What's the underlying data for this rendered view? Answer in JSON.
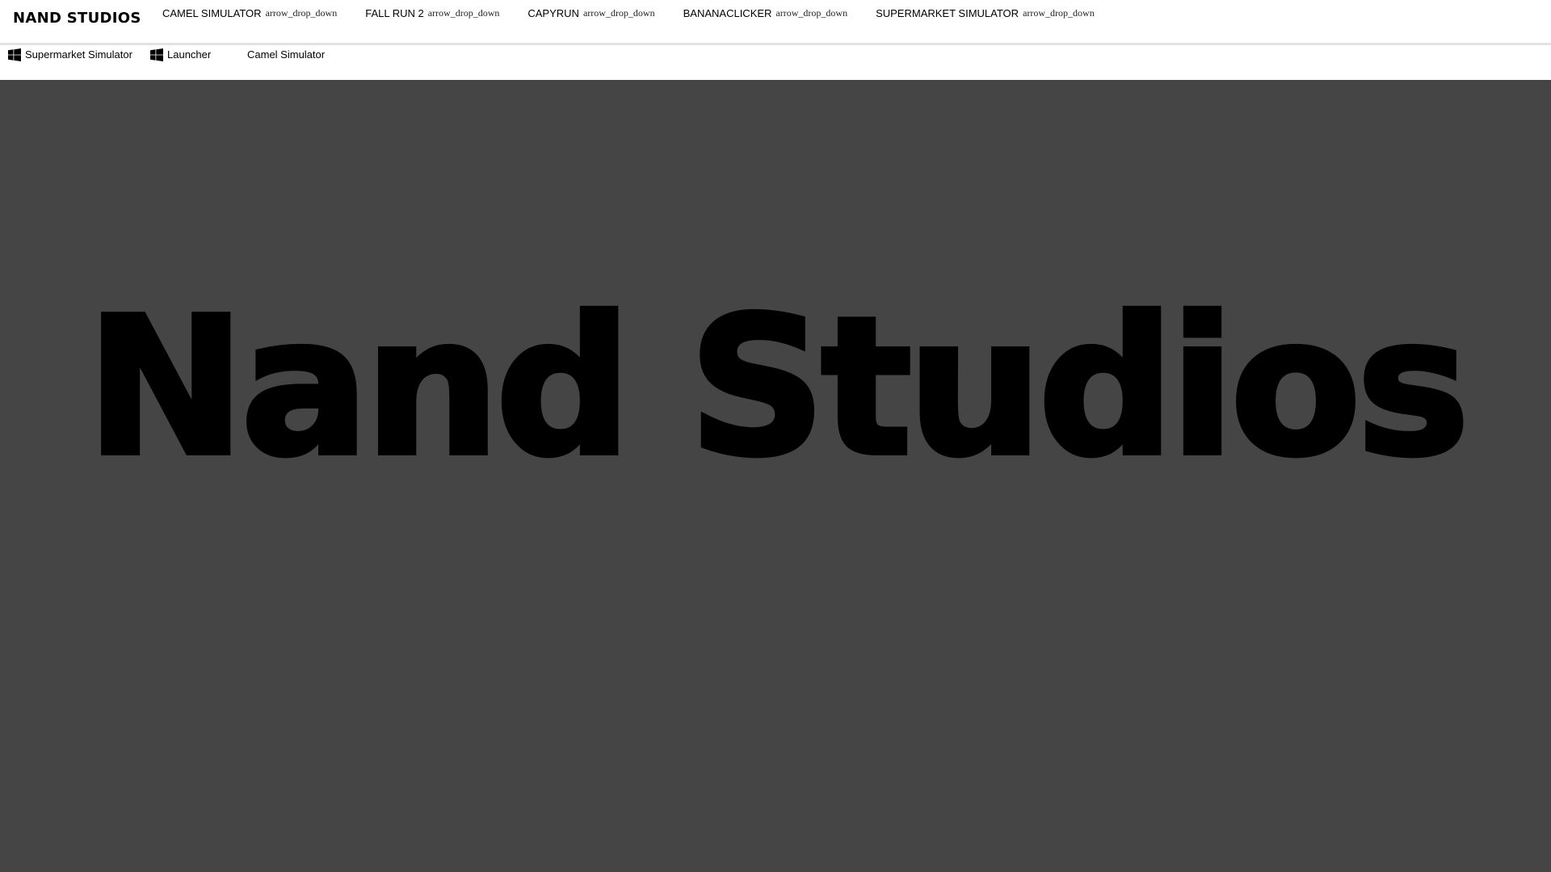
{
  "header": {
    "brand": "NAND STUDIOS",
    "nav": [
      {
        "label": "CAMEL SIMULATOR",
        "icon": "arrow_drop_down"
      },
      {
        "label": "FALL RUN 2",
        "icon": "arrow_drop_down"
      },
      {
        "label": "CAPYRUN",
        "icon": "arrow_drop_down"
      },
      {
        "label": "BANANACLICKER",
        "icon": "arrow_drop_down"
      },
      {
        "label": "SUPERMARKET SIMULATOR",
        "icon": "arrow_drop_down"
      }
    ]
  },
  "bookmarks": [
    {
      "label": "Supermarket Simulator",
      "icon": "windows-icon"
    },
    {
      "label": "Launcher",
      "icon": "windows-icon"
    },
    {
      "label": "Camel Simulator",
      "icon": ""
    }
  ],
  "hero": {
    "title": "Nand Studios"
  },
  "colors": {
    "hero_background": "#454545",
    "header_background": "#ffffff",
    "title_color": "#000000"
  }
}
